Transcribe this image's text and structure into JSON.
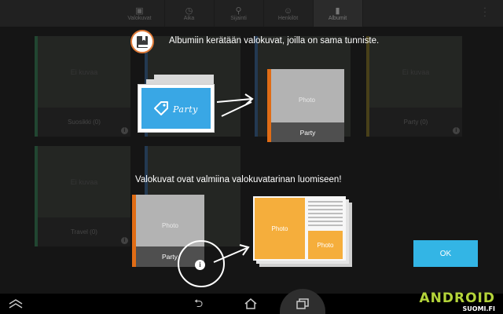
{
  "topbar": {
    "tabs": [
      {
        "label": "Valokuvat",
        "icon": "photo-icon"
      },
      {
        "label": "Aika",
        "icon": "clock-icon"
      },
      {
        "label": "Sijainti",
        "icon": "location-pin-icon"
      },
      {
        "label": "Henkilöt",
        "icon": "face-icon"
      },
      {
        "label": "Albumit",
        "icon": "book-icon",
        "active": true
      }
    ]
  },
  "albums": [
    {
      "name": "Suosikki (0)",
      "placeholder": "Ei kuvaa",
      "stripe": "#2b5a3f"
    },
    {
      "name": "",
      "placeholder": "",
      "stripe": "#2e4a6a"
    },
    {
      "name": "",
      "placeholder": "",
      "stripe": "#2e4a6a"
    },
    {
      "name": "Party (0)",
      "placeholder": "Ei kuvaa",
      "stripe": "#5d5320"
    },
    {
      "name": "Travel (0)",
      "placeholder": "Ei kuvaa",
      "stripe": "#2b5a3f"
    },
    {
      "name": "",
      "placeholder": "",
      "stripe": "#2e4a6a"
    }
  ],
  "overlay": {
    "line1": "Albumiin kerätään valokuvat, joilla on sama tunniste.",
    "line2": "Valokuvat ovat valmiina valokuvatarinan luomiseen!",
    "party_tag": "Party",
    "card_top": {
      "photo": "Photo",
      "name": "Party"
    },
    "card_bottom": {
      "photo": "Photo",
      "name": "Party"
    },
    "story": {
      "photo_large": "Photo",
      "photo_small": "Photo"
    },
    "ok": "OK"
  },
  "brand": {
    "line1": "ANDROID",
    "line2": "SUOMI.FI"
  },
  "colors": {
    "accent": "#33b5e5",
    "album_bar": "#e06c15",
    "story_photo": "#f5ae3c",
    "brand": "#b4d43a"
  }
}
